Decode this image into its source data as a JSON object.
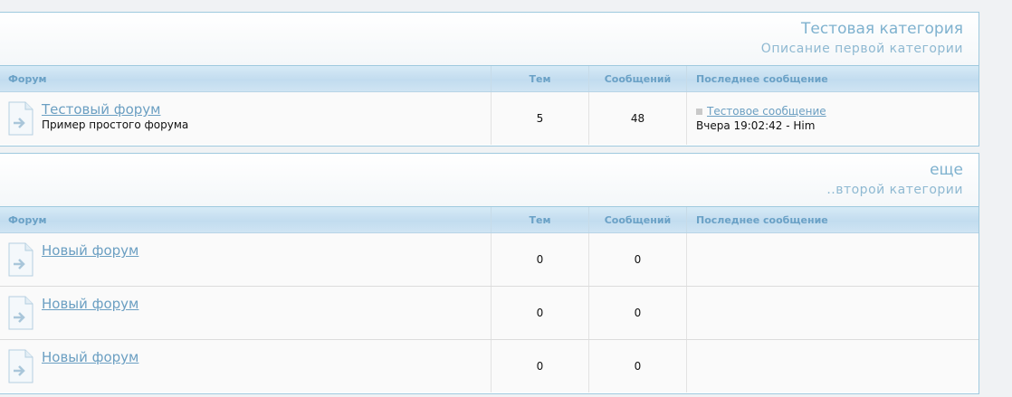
{
  "categories": [
    {
      "title": "Тестовая категория",
      "description": "Описание первой категории",
      "headers": {
        "forum": "Форум",
        "topics": "Тем",
        "posts": "Сообщений",
        "last": "Последнее сообщение"
      },
      "forums": [
        {
          "name": "Тестовый форум",
          "description": "Пример простого форума",
          "topics": "5",
          "posts": "48",
          "last_title": "Тестовое сообщение",
          "last_meta": "Вчера 19:02:42 - Him"
        }
      ]
    },
    {
      "title": "еще",
      "description": "..второй категории",
      "headers": {
        "forum": "Форум",
        "topics": "Тем",
        "posts": "Сообщений",
        "last": "Последнее сообщение"
      },
      "forums": [
        {
          "name": "Новый форум",
          "description": "",
          "topics": "0",
          "posts": "0",
          "last_title": "",
          "last_meta": ""
        },
        {
          "name": "Новый форум",
          "description": "",
          "topics": "0",
          "posts": "0",
          "last_title": "",
          "last_meta": ""
        },
        {
          "name": "Новый форум",
          "description": "",
          "topics": "0",
          "posts": "0",
          "last_title": "",
          "last_meta": ""
        }
      ]
    }
  ],
  "icons": {
    "forum": "forum-page-arrow-icon",
    "last_post": "post-square-icon"
  },
  "colors": {
    "accent": "#6b9fc2",
    "border": "#9fc9de",
    "header_bg": "#c2dcef"
  }
}
